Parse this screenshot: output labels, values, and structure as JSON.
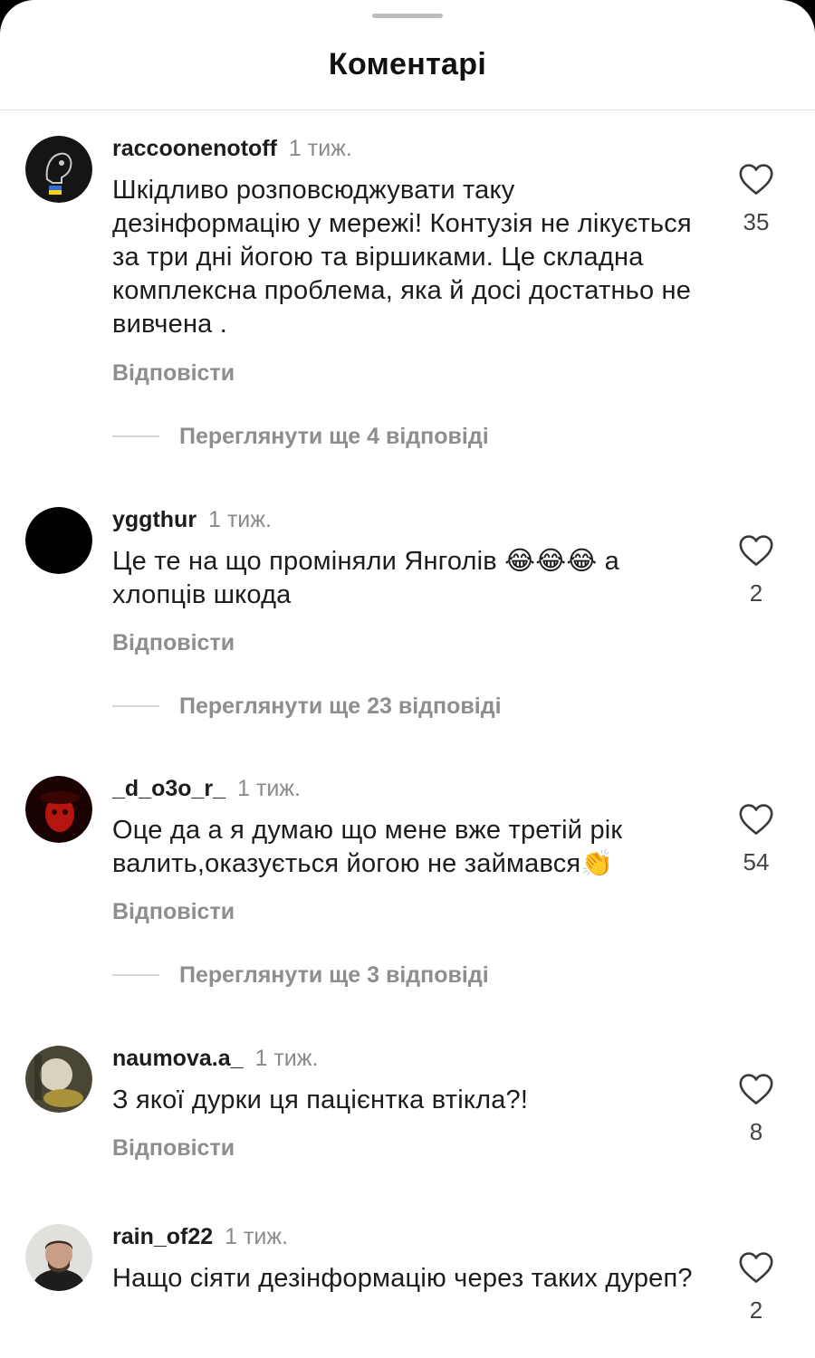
{
  "sheet": {
    "title": "Коментарі"
  },
  "comments": [
    {
      "username": "raccoonenotoff",
      "time": "1 тиж.",
      "text": "Шкідливо розповсюджувати таку дезінформацію у мережі! Контузія не лікується за три дні йогою та віршиками. Це складна комплексна проблема, яка й досі достатньо не вивчена .",
      "likes": "35",
      "reply_label": "Відповісти",
      "view_replies": "Переглянути ще 4 відповіді"
    },
    {
      "username": "yggthur",
      "time": "1 тиж.",
      "text": "Це те на що проміняли Янголів 😂😂😂 а хлопців шкода",
      "likes": "2",
      "reply_label": "Відповісти",
      "view_replies": "Переглянути ще 23 відповіді"
    },
    {
      "username": "_d_o3o_r_",
      "time": "1 тиж.",
      "text": "Оце да а я думаю що мене вже третій рік валить,оказується йогою не займався👏",
      "likes": "54",
      "reply_label": "Відповісти",
      "view_replies": "Переглянути ще 3 відповіді"
    },
    {
      "username": "naumova.a_",
      "time": "1 тиж.",
      "text": "З якої дурки ця пацієнтка втікла?!",
      "likes": "8",
      "reply_label": "Відповісти"
    },
    {
      "username": "rain_of22",
      "time": "1 тиж.",
      "text": "Нащо сіяти дезінформацію через таких дуреп?",
      "likes": "2"
    }
  ],
  "icons": {
    "like": "heart-outline-icon"
  },
  "colors": {
    "secondary_text": "#8e8e8e",
    "background": "#ffffff"
  }
}
